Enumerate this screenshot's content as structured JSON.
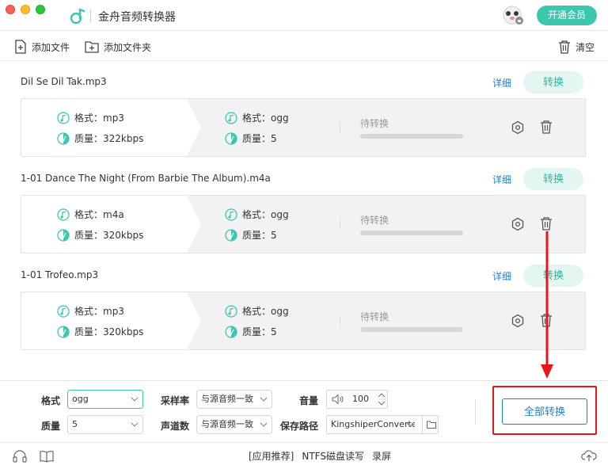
{
  "window": {
    "title": "金舟音频转换器"
  },
  "header": {
    "vip_label": "开通会员"
  },
  "toolbar": {
    "add_file": "添加文件",
    "add_folder": "添加文件夹",
    "clear": "清空"
  },
  "files": [
    {
      "name": "Dil Se Dil Tak.mp3",
      "detail": "详细",
      "convert": "转换",
      "src_format": "格式：mp3",
      "src_quality": "质量：322kbps",
      "dst_format": "格式：ogg",
      "dst_quality": "质量：5",
      "status": "待转换",
      "progress": 0
    },
    {
      "name": "1-01 Dance The Night (From Barbie The Album).m4a",
      "detail": "详细",
      "convert": "转换",
      "src_format": "格式：m4a",
      "src_quality": "质量：320kbps",
      "dst_format": "格式：ogg",
      "dst_quality": "质量：5",
      "status": "待转换",
      "progress": 0
    },
    {
      "name": "1-01 Trofeo.mp3",
      "detail": "详细",
      "convert": "转换",
      "src_format": "格式：mp3",
      "src_quality": "质量：320kbps",
      "dst_format": "格式：ogg",
      "dst_quality": "质量：5",
      "status": "待转换",
      "progress": 0
    }
  ],
  "settings": {
    "format_label": "格式",
    "format_value": "ogg",
    "quality_label": "质量",
    "quality_value": "5",
    "samplerate_label": "采样率",
    "samplerate_value": "与源音频一致",
    "channels_label": "声道数",
    "channels_value": "与源音频一致",
    "volume_label": "音量",
    "volume_value": "100",
    "savepath_label": "保存路径",
    "savepath_value": "KingshiperConverter",
    "convert_all": "全部转换"
  },
  "statusbar": {
    "links": [
      "[应用推荐]",
      "NTFS磁盘读写",
      "录屏"
    ]
  },
  "colors": {
    "accent": "#3fc7ad",
    "link": "#1e7fd6",
    "highlight": "#e8151b"
  }
}
